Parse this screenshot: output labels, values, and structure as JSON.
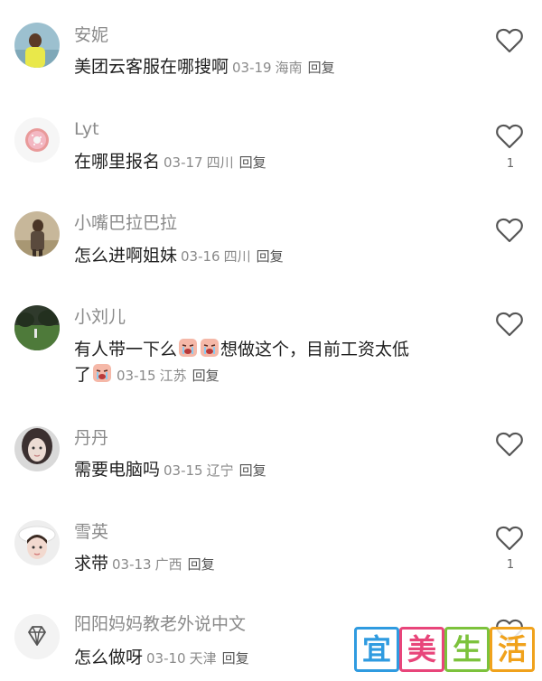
{
  "comments": [
    {
      "user": "安妮",
      "text": "美团云客服在哪搜啊",
      "date": "03-19",
      "location": "海南",
      "reply": "回复",
      "likes": ""
    },
    {
      "user": "Lyt",
      "text": "在哪里报名",
      "date": "03-17",
      "location": "四川",
      "reply": "回复",
      "likes": "1"
    },
    {
      "user": "小嘴巴拉巴拉",
      "text": "怎么进啊姐妹",
      "date": "03-16",
      "location": "四川",
      "reply": "回复",
      "likes": ""
    },
    {
      "user": "小刘儿",
      "text_part1": "有人带一下么",
      "text_part2": "想做这个，目前工资太低",
      "text_part3": "了",
      "date": "03-15",
      "location": "江苏",
      "reply": "回复",
      "likes": ""
    },
    {
      "user": "丹丹",
      "text": "需要电脑吗",
      "date": "03-15",
      "location": "辽宁",
      "reply": "回复",
      "likes": ""
    },
    {
      "user": "雪英",
      "text": "求带",
      "date": "03-13",
      "location": "广西",
      "reply": "回复",
      "likes": "1"
    },
    {
      "user": "阳阳妈妈教老外说中文",
      "text": "怎么做呀",
      "date": "03-10",
      "location": "天津",
      "reply": "回复",
      "likes": ""
    }
  ],
  "watermark": {
    "chars": [
      "宜",
      "美",
      "生",
      "活"
    ],
    "colors": [
      "#2f9be0",
      "#e8457a",
      "#7cc23c",
      "#f0a21c"
    ]
  },
  "icons": {
    "like": "heart-outline-icon",
    "emoji": "crying-face-emoji-icon"
  }
}
